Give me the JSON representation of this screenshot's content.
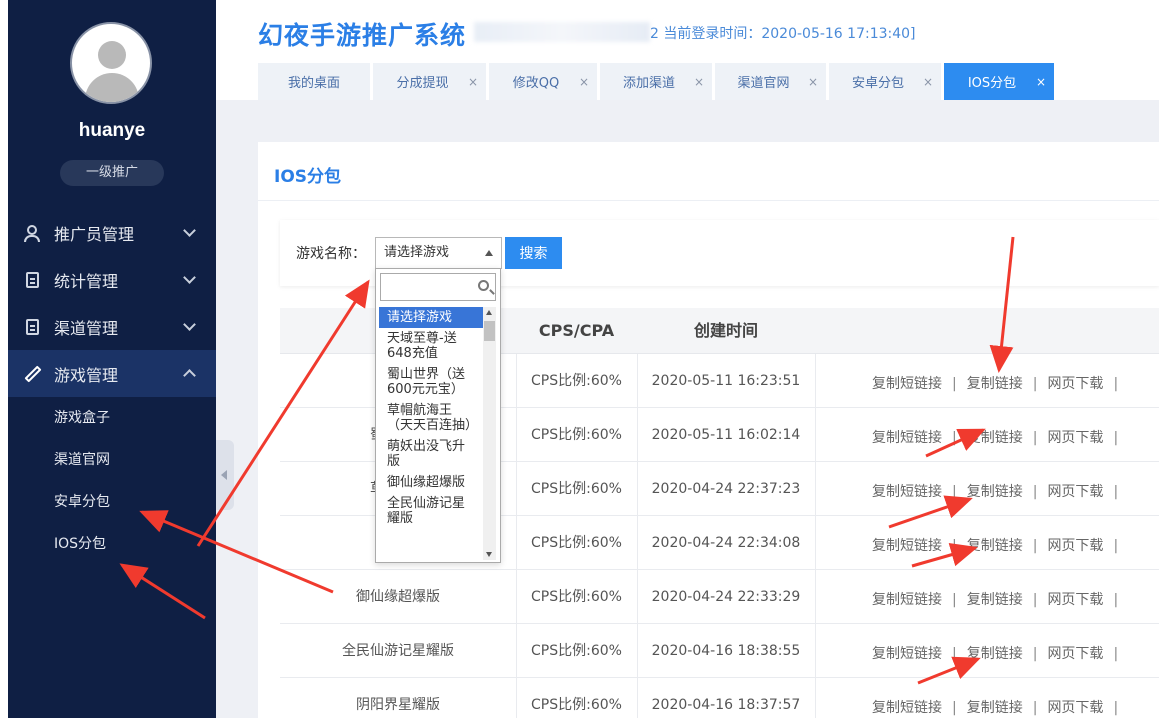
{
  "sidebar": {
    "username": "huanye",
    "role": "一级推广",
    "menu": [
      {
        "label": "推广员管理",
        "icon": "user-icon"
      },
      {
        "label": "统计管理",
        "icon": "list-icon"
      },
      {
        "label": "渠道管理",
        "icon": "document-icon"
      },
      {
        "label": "游戏管理",
        "icon": "pencil-icon"
      }
    ],
    "submenu": [
      "游戏盒子",
      "渠道官网",
      "安卓分包",
      "IOS分包"
    ]
  },
  "header": {
    "title": "幻夜手游推广系统",
    "login_info": "2 当前登录时间：2020-05-16 17:13:40]",
    "tabs": [
      {
        "label": "我的桌面"
      },
      {
        "label": "分成提现",
        "close": "×"
      },
      {
        "label": "修改QQ",
        "close": "×"
      },
      {
        "label": "添加渠道",
        "close": "×"
      },
      {
        "label": "渠道官网",
        "close": "×"
      },
      {
        "label": "安卓分包",
        "close": "×"
      },
      {
        "label": "IOS分包",
        "close": "×"
      }
    ]
  },
  "panel": {
    "title": "IOS分包",
    "filter_label": "游戏名称：",
    "select_value": "请选择游戏",
    "search_button": "搜索"
  },
  "table": {
    "headers": [
      "CPS/CPA",
      "创建时间"
    ],
    "action_labels": {
      "short_link": "复制短链接",
      "link": "复制链接",
      "download": "网页下载",
      "sep": "|"
    },
    "rows": [
      {
        "name": "天域至",
        "ratio": "CPS比例:60%",
        "created": "2020-05-11 16:23:51"
      },
      {
        "name": "蜀山世界",
        "ratio": "CPS比例:60%",
        "created": "2020-05-11 16:02:14"
      },
      {
        "name": "草帽航海",
        "ratio": "CPS比例:60%",
        "created": "2020-04-24 22:37:23"
      },
      {
        "name": "萌",
        "ratio": "CPS比例:60%",
        "created": "2020-04-24 22:34:08"
      },
      {
        "name": "御仙缘超爆版",
        "ratio": "CPS比例:60%",
        "created": "2020-04-24 22:33:29"
      },
      {
        "name": "全民仙游记星耀版",
        "ratio": "CPS比例:60%",
        "created": "2020-04-16 18:38:55"
      },
      {
        "name": "阴阳界星耀版",
        "ratio": "CPS比例:60%",
        "created": "2020-04-16 18:37:57"
      }
    ]
  },
  "dropdown": {
    "options": [
      "请选择游戏",
      "天域至尊-送648充值",
      "蜀山世界（送600元元宝）",
      "草帽航海王（天天百连抽）",
      "萌妖出没飞升版",
      "御仙缘超爆版",
      "全民仙游记星耀版"
    ]
  },
  "colors": {
    "accent": "#2d8cf0",
    "sidebar": "#0f1f44",
    "arrow": "#f03a2e"
  }
}
